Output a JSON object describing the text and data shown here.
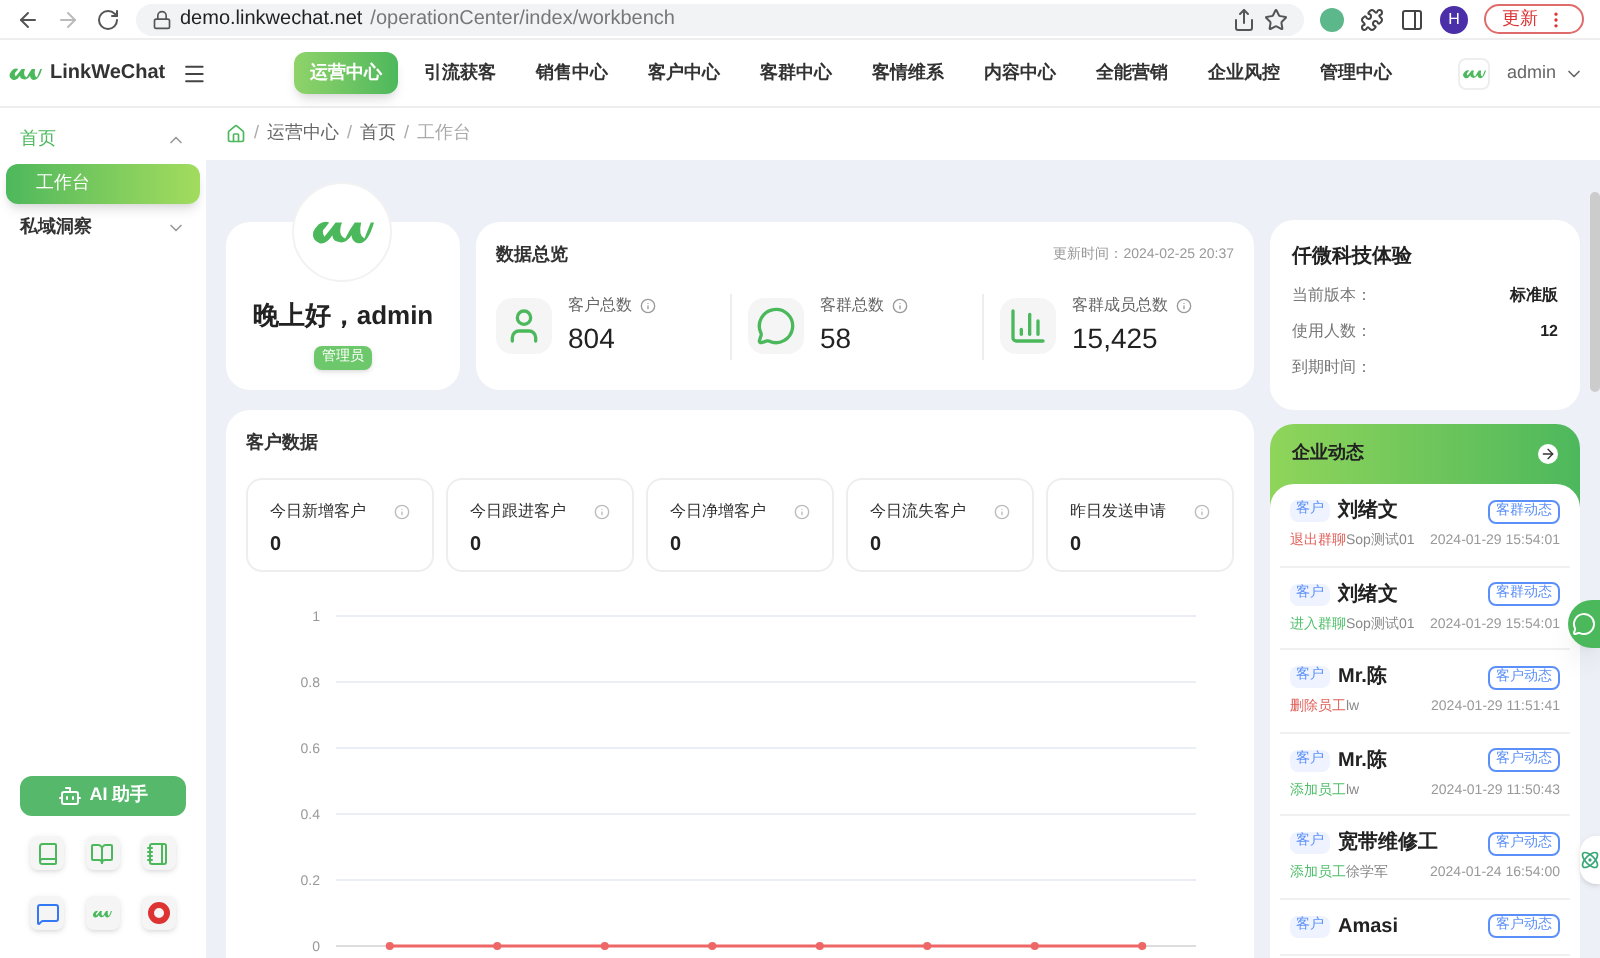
{
  "browser": {
    "url_host": "demo.linkwechat.net",
    "url_path": "/operationCenter/index/workbench",
    "profile": "H",
    "update_button": "更新"
  },
  "header": {
    "logo": "LinkWeChat",
    "nav": [
      {
        "label": "运营中心",
        "selected": true
      },
      {
        "label": "引流获客",
        "selected": false
      },
      {
        "label": "销售中心",
        "selected": false
      },
      {
        "label": "客户中心",
        "selected": false
      },
      {
        "label": "客群中心",
        "selected": false
      },
      {
        "label": "客情维系",
        "selected": false
      },
      {
        "label": "内容中心",
        "selected": false
      },
      {
        "label": "全能营销",
        "selected": false
      },
      {
        "label": "企业风控",
        "selected": false
      },
      {
        "label": "管理中心",
        "selected": false
      }
    ],
    "user": "admin"
  },
  "sidebar": {
    "items": [
      {
        "label": "首页",
        "expanded": true,
        "children": [
          {
            "label": "工作台",
            "selected": true
          }
        ]
      },
      {
        "label": "私域洞察",
        "expanded": false
      }
    ],
    "ai_button": "AI 助手"
  },
  "breadcrumb": [
    "运营中心",
    "首页",
    "工作台"
  ],
  "breadcrumb_separator": "/",
  "profile": {
    "greeting": "晚上好，admin",
    "role": "管理员"
  },
  "overview": {
    "title": "数据总览",
    "updated": "更新时间：2024-02-25 20:37",
    "stats": [
      {
        "kind": "user",
        "label": "客户总数",
        "value": "804"
      },
      {
        "kind": "chat",
        "label": "客群总数",
        "value": "58"
      },
      {
        "kind": "chart",
        "label": "客群成员总数",
        "value": "15,425"
      }
    ]
  },
  "customer_data": {
    "title": "客户数据",
    "cards": [
      {
        "label": "今日新增客户",
        "value": "0"
      },
      {
        "label": "今日跟进客户",
        "value": "0"
      },
      {
        "label": "今日净增客户",
        "value": "0"
      },
      {
        "label": "今日流失客户",
        "value": "0"
      },
      {
        "label": "昨日发送申请",
        "value": "0"
      }
    ],
    "chart_data": {
      "type": "line",
      "grid": true,
      "ylim": [
        0,
        1
      ],
      "yticks": [
        0,
        0.2,
        0.4,
        0.6,
        0.8,
        1
      ],
      "series": [
        {
          "color": "#ee6666",
          "marker": true,
          "values": [
            0,
            0,
            0,
            0,
            0,
            0,
            0,
            0
          ]
        }
      ]
    }
  },
  "company": {
    "title": "仟微科技体验",
    "rows": [
      {
        "label": "当前版本：",
        "value": "标准版"
      },
      {
        "label": "使用人数：",
        "value": "12"
      },
      {
        "label": "到期时间：",
        "value": ""
      }
    ]
  },
  "feed": {
    "title": "企业动态",
    "items": [
      {
        "tag": "客户",
        "name": "刘绪文",
        "button": "客群动态",
        "action": "退出群聊",
        "color": "#e0605a",
        "target": "Sop测试01",
        "time": "2024-01-29 15:54:01"
      },
      {
        "tag": "客户",
        "name": "刘绪文",
        "button": "客群动态",
        "action": "进入群聊",
        "color": "#4fbf6a",
        "target": "Sop测试01",
        "time": "2024-01-29 15:54:01"
      },
      {
        "tag": "客户",
        "name": "Mr.陈",
        "button": "客户动态",
        "action": "删除员工",
        "color": "#e0605a",
        "target": "lw",
        "time": "2024-01-29 11:51:41"
      },
      {
        "tag": "客户",
        "name": "Mr.陈",
        "button": "客户动态",
        "action": "添加员工",
        "color": "#4fbf6a",
        "target": "lw",
        "time": "2024-01-29 11:50:43"
      },
      {
        "tag": "客户",
        "name": "宽带维修工",
        "button": "客户动态",
        "action": "添加员工",
        "color": "#4fbf6a",
        "target": "徐学军",
        "time": "2024-01-24 16:54:00"
      },
      {
        "tag": "客户",
        "name": "Amasi",
        "button": "客户动态"
      }
    ]
  }
}
